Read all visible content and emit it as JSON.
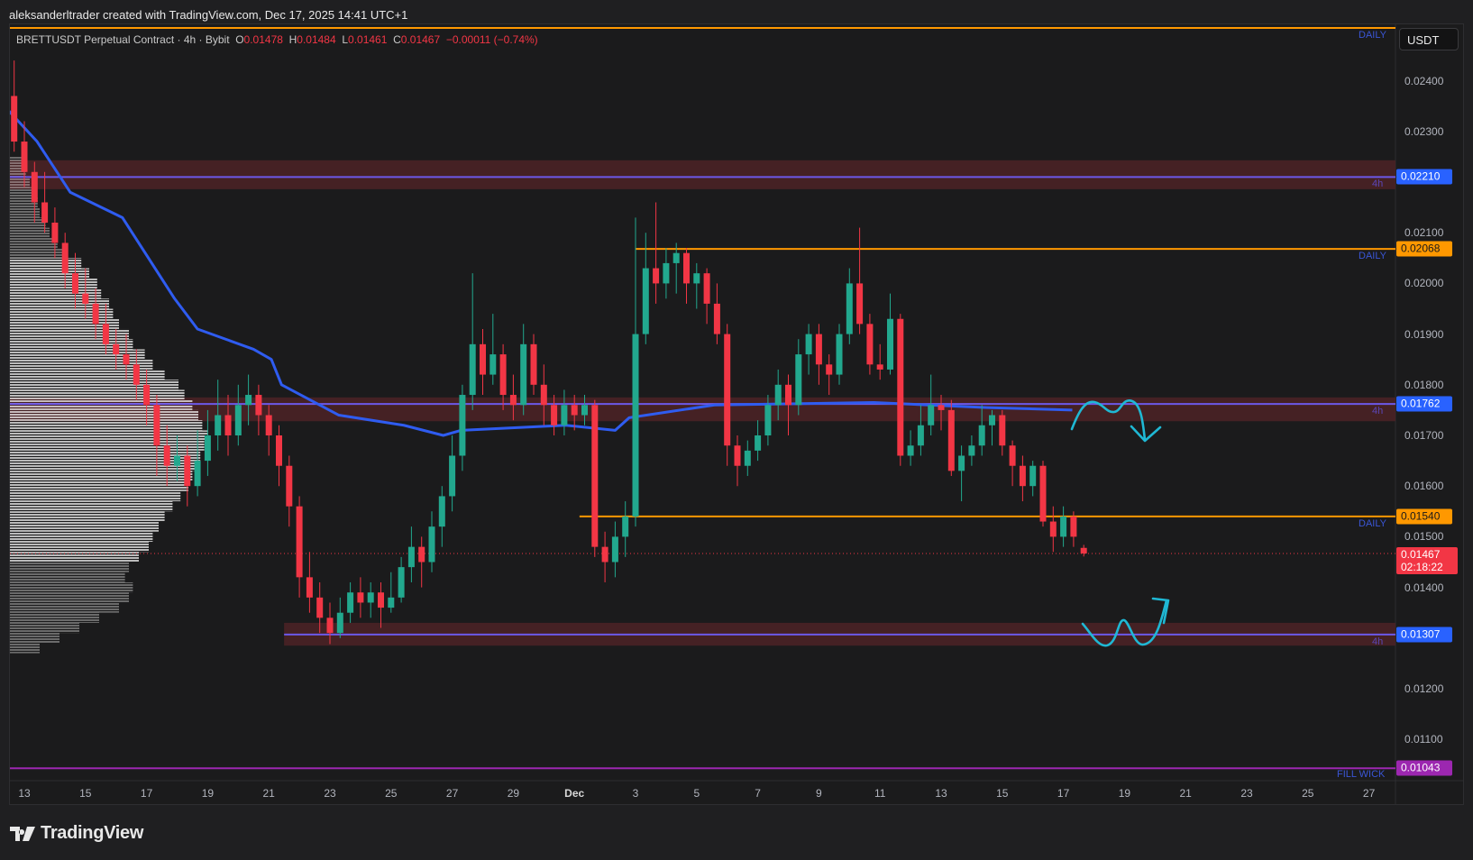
{
  "credit": "aleksanderltrader created with TradingView.com, Dec 17, 2025 14:41 UTC+1",
  "legend": {
    "symbol": "BRETTUSDT Perpetual Contract · 4h · Bybit",
    "o_label": "O",
    "o": "0.01478",
    "h_label": "H",
    "h": "0.01484",
    "l_label": "L",
    "l": "0.01461",
    "c_label": "C",
    "c": "0.01467",
    "change": "−0.00011 (−0.74%)"
  },
  "currency_button": "USDT",
  "logo": "TradingView",
  "colors": {
    "up": "#22a88e",
    "down": "#f23645",
    "vwap": "#2f5cf0",
    "zone": "#4a2226",
    "level_4h": "#6c58e8",
    "daily": "#ff9800",
    "fill_wick": "#9c27b0",
    "drawing": "#1fb8d4",
    "current": "#f23645"
  },
  "price_axis": {
    "ticks": [
      "0.02400",
      "0.02300",
      "0.02100",
      "0.02000",
      "0.01900",
      "0.01800",
      "0.01700",
      "0.01600",
      "0.01500",
      "0.01400",
      "0.01200",
      "0.01100"
    ]
  },
  "time_axis": {
    "ticks": [
      "13",
      "15",
      "17",
      "19",
      "21",
      "23",
      "25",
      "27",
      "29",
      "Dec",
      "3",
      "5",
      "7",
      "9",
      "11",
      "13",
      "15",
      "17",
      "19",
      "21",
      "23",
      "25",
      "27"
    ]
  },
  "levels": [
    {
      "kind": "zone",
      "price": 0.0221,
      "label": "0.02210",
      "zone_top": 0.02243,
      "zone_bottom": 0.02186,
      "tf": "4h",
      "start": "2025-11-12T12:00"
    },
    {
      "kind": "daily",
      "price": 0.02068,
      "label": "0.02068",
      "tf": "DAILY",
      "start": "2025-12-03T00:00"
    },
    {
      "kind": "zone",
      "price": 0.01762,
      "label": "0.01762",
      "zone_top": 0.01775,
      "zone_bottom": 0.01728,
      "tf": "4h",
      "start": "2025-11-12T12:00"
    },
    {
      "kind": "daily",
      "price": 0.0154,
      "label": "0.01540",
      "tf": "DAILY",
      "start": "2025-12-01T04:00"
    },
    {
      "kind": "zone",
      "price": 0.01307,
      "label": "0.01307",
      "zone_top": 0.0133,
      "zone_bottom": 0.01285,
      "tf": "4h",
      "start": "2025-11-21T12:00"
    },
    {
      "kind": "fill_wick",
      "price": 0.01043,
      "label": "0.01043",
      "tf": "FILL WICK",
      "start": "2025-11-12T12:00"
    },
    {
      "kind": "daily_top",
      "price": 0.02504,
      "tf": "DAILY",
      "start": "2025-11-12T12:00"
    }
  ],
  "current_price": {
    "price": 0.01467,
    "label": "0.01467",
    "countdown": "02:18:22"
  },
  "chart_data": {
    "type": "candlestick",
    "candles_start": "2025-11-12T16:00",
    "candles": [
      [
        0.0237,
        0.0244,
        0.0226,
        0.0228
      ],
      [
        0.0228,
        0.0232,
        0.0219,
        0.0222
      ],
      [
        0.0222,
        0.0224,
        0.0212,
        0.0216
      ],
      [
        0.0216,
        0.0222,
        0.021,
        0.0212
      ],
      [
        0.0212,
        0.0215,
        0.0205,
        0.0208
      ],
      [
        0.0208,
        0.021,
        0.0199,
        0.0202
      ],
      [
        0.0202,
        0.0206,
        0.0195,
        0.0198
      ],
      [
        0.0198,
        0.0203,
        0.0193,
        0.0196
      ],
      [
        0.0196,
        0.0199,
        0.0189,
        0.0192
      ],
      [
        0.0192,
        0.0196,
        0.0186,
        0.0188
      ],
      [
        0.0188,
        0.0191,
        0.0183,
        0.0186
      ],
      [
        0.0186,
        0.019,
        0.0181,
        0.0184
      ],
      [
        0.0184,
        0.0187,
        0.0177,
        0.018
      ],
      [
        0.018,
        0.0183,
        0.0172,
        0.0176
      ],
      [
        0.0176,
        0.0178,
        0.0162,
        0.0168
      ],
      [
        0.0168,
        0.0172,
        0.016,
        0.0164
      ],
      [
        0.0164,
        0.017,
        0.0161,
        0.0166
      ],
      [
        0.0166,
        0.0168,
        0.0156,
        0.016
      ],
      [
        0.016,
        0.0171,
        0.0158,
        0.0165
      ],
      [
        0.0165,
        0.0175,
        0.0162,
        0.017
      ],
      [
        0.017,
        0.0181,
        0.0167,
        0.0174
      ],
      [
        0.0174,
        0.0178,
        0.0166,
        0.017
      ],
      [
        0.017,
        0.018,
        0.0168,
        0.0176
      ],
      [
        0.0176,
        0.0182,
        0.0172,
        0.0178
      ],
      [
        0.0178,
        0.018,
        0.017,
        0.0174
      ],
      [
        0.0174,
        0.0176,
        0.0166,
        0.017
      ],
      [
        0.017,
        0.0172,
        0.016,
        0.0164
      ],
      [
        0.0164,
        0.0166,
        0.0152,
        0.0156
      ],
      [
        0.0156,
        0.0158,
        0.0138,
        0.0142
      ],
      [
        0.0142,
        0.0147,
        0.0135,
        0.0138
      ],
      [
        0.0138,
        0.0141,
        0.0131,
        0.0134
      ],
      [
        0.0134,
        0.0137,
        0.01288,
        0.0131
      ],
      [
        0.0131,
        0.0138,
        0.013,
        0.0135
      ],
      [
        0.0135,
        0.0141,
        0.0133,
        0.0139
      ],
      [
        0.0139,
        0.0142,
        0.0134,
        0.0137
      ],
      [
        0.0137,
        0.0141,
        0.0134,
        0.0139
      ],
      [
        0.0139,
        0.0141,
        0.0132,
        0.0136
      ],
      [
        0.0136,
        0.0143,
        0.0135,
        0.0138
      ],
      [
        0.0138,
        0.0146,
        0.0137,
        0.0144
      ],
      [
        0.0144,
        0.0152,
        0.0141,
        0.0148
      ],
      [
        0.0148,
        0.015,
        0.014,
        0.0145
      ],
      [
        0.0145,
        0.0155,
        0.0143,
        0.0152
      ],
      [
        0.0152,
        0.016,
        0.0148,
        0.0158
      ],
      [
        0.0158,
        0.017,
        0.0155,
        0.0166
      ],
      [
        0.0166,
        0.018,
        0.0163,
        0.0178
      ],
      [
        0.0178,
        0.0202,
        0.0175,
        0.0188
      ],
      [
        0.0188,
        0.0191,
        0.0178,
        0.0182
      ],
      [
        0.0182,
        0.0194,
        0.018,
        0.0186
      ],
      [
        0.0186,
        0.0188,
        0.0175,
        0.0178
      ],
      [
        0.0178,
        0.0182,
        0.0173,
        0.0176
      ],
      [
        0.0176,
        0.0192,
        0.0174,
        0.0188
      ],
      [
        0.0188,
        0.019,
        0.0178,
        0.018
      ],
      [
        0.018,
        0.0184,
        0.0172,
        0.0176
      ],
      [
        0.0176,
        0.0178,
        0.017,
        0.0172
      ],
      [
        0.0172,
        0.0179,
        0.017,
        0.0176
      ],
      [
        0.0176,
        0.0178,
        0.0171,
        0.0174
      ],
      [
        0.0174,
        0.0178,
        0.0172,
        0.0176
      ],
      [
        0.0176,
        0.0177,
        0.0146,
        0.0148
      ],
      [
        0.0148,
        0.0151,
        0.0141,
        0.0145
      ],
      [
        0.0145,
        0.0153,
        0.0142,
        0.015
      ],
      [
        0.015,
        0.0157,
        0.0146,
        0.0154
      ],
      [
        0.0154,
        0.0213,
        0.0152,
        0.019
      ],
      [
        0.019,
        0.021,
        0.0188,
        0.0203
      ],
      [
        0.0203,
        0.0216,
        0.0196,
        0.02
      ],
      [
        0.02,
        0.0207,
        0.0197,
        0.0204
      ],
      [
        0.0204,
        0.0208,
        0.0198,
        0.0206
      ],
      [
        0.0206,
        0.0207,
        0.0196,
        0.02
      ],
      [
        0.02,
        0.0204,
        0.0195,
        0.0202
      ],
      [
        0.0202,
        0.0203,
        0.0192,
        0.0196
      ],
      [
        0.0196,
        0.02,
        0.0188,
        0.019
      ],
      [
        0.019,
        0.0192,
        0.0164,
        0.0168
      ],
      [
        0.0168,
        0.017,
        0.016,
        0.0164
      ],
      [
        0.0164,
        0.0169,
        0.0162,
        0.0167
      ],
      [
        0.0167,
        0.0173,
        0.0165,
        0.017
      ],
      [
        0.017,
        0.0178,
        0.0168,
        0.0176
      ],
      [
        0.0176,
        0.0183,
        0.0173,
        0.018
      ],
      [
        0.018,
        0.0182,
        0.017,
        0.0176
      ],
      [
        0.0176,
        0.0189,
        0.0174,
        0.0186
      ],
      [
        0.0186,
        0.0192,
        0.0182,
        0.019
      ],
      [
        0.019,
        0.0192,
        0.018,
        0.0184
      ],
      [
        0.0184,
        0.0186,
        0.0178,
        0.0182
      ],
      [
        0.0182,
        0.0192,
        0.018,
        0.019
      ],
      [
        0.019,
        0.0203,
        0.0188,
        0.02
      ],
      [
        0.02,
        0.0211,
        0.019,
        0.0192
      ],
      [
        0.0192,
        0.0194,
        0.0182,
        0.0184
      ],
      [
        0.0184,
        0.0188,
        0.0181,
        0.0183
      ],
      [
        0.0183,
        0.0198,
        0.0182,
        0.0193
      ],
      [
        0.0193,
        0.0194,
        0.0164,
        0.0166
      ],
      [
        0.0166,
        0.0171,
        0.0164,
        0.0168
      ],
      [
        0.0168,
        0.0176,
        0.0166,
        0.0172
      ],
      [
        0.0172,
        0.0182,
        0.017,
        0.0176
      ],
      [
        0.0176,
        0.0178,
        0.0171,
        0.0175
      ],
      [
        0.0175,
        0.0177,
        0.0162,
        0.0163
      ],
      [
        0.0163,
        0.0168,
        0.0157,
        0.0166
      ],
      [
        0.0166,
        0.017,
        0.0164,
        0.0168
      ],
      [
        0.0168,
        0.0176,
        0.0166,
        0.0172
      ],
      [
        0.0172,
        0.0175,
        0.0168,
        0.0174
      ],
      [
        0.0174,
        0.0175,
        0.0166,
        0.0168
      ],
      [
        0.0168,
        0.0169,
        0.016,
        0.0164
      ],
      [
        0.0164,
        0.0166,
        0.0157,
        0.016
      ],
      [
        0.016,
        0.0165,
        0.0158,
        0.0164
      ],
      [
        0.0164,
        0.0165,
        0.0152,
        0.0153
      ],
      [
        0.0153,
        0.0156,
        0.0147,
        0.015
      ],
      [
        0.015,
        0.0156,
        0.0148,
        0.0154
      ],
      [
        0.0154,
        0.0155,
        0.0148,
        0.015
      ],
      [
        0.01478,
        0.01484,
        0.01461,
        0.01467
      ]
    ],
    "vwap": [
      [
        "2025-11-12T12:00",
        0.0234
      ],
      [
        "2025-11-13T10:00",
        0.0228
      ],
      [
        "2025-11-14T12:00",
        0.0218
      ],
      [
        "2025-11-16T05:00",
        0.0213
      ],
      [
        "2025-11-17T22:00",
        0.0197
      ],
      [
        "2025-11-18T16:00",
        0.0191
      ],
      [
        "2025-11-20T12:00",
        0.0187
      ],
      [
        "2025-11-21T02:00",
        0.0185
      ],
      [
        "2025-11-21T10:00",
        0.018
      ],
      [
        "2025-11-23T07:00",
        0.0174
      ],
      [
        "2025-11-25T10:00",
        0.0172
      ],
      [
        "2025-11-26T17:00",
        0.017
      ],
      [
        "2025-11-27T07:00",
        0.0171
      ],
      [
        "2025-11-30T17:00",
        0.0172
      ],
      [
        "2025-12-02T08:00",
        0.0171
      ],
      [
        "2025-12-02T19:00",
        0.01735
      ],
      [
        "2025-12-05T14:00",
        0.0176
      ],
      [
        "2025-12-10T19:00",
        0.01765
      ],
      [
        "2025-12-14T12:00",
        0.01755
      ],
      [
        "2025-12-17T07:00",
        0.0175
      ]
    ],
    "volume_profile": {
      "bin_start": 0.0128,
      "bin_step": 0.0002,
      "value_area": [
        0.0146,
        0.0204
      ],
      "relative_volume": [
        15,
        25,
        35,
        45,
        55,
        60,
        62,
        58,
        60,
        65,
        70,
        72,
        75,
        78,
        82,
        86,
        90,
        92,
        94,
        96,
        98,
        100,
        97,
        95,
        92,
        88,
        85,
        78,
        72,
        68,
        62,
        60,
        55,
        52,
        50,
        46,
        44,
        40,
        36,
        28,
        24,
        20,
        18,
        15,
        14,
        12,
        10,
        8,
        6
      ]
    }
  }
}
